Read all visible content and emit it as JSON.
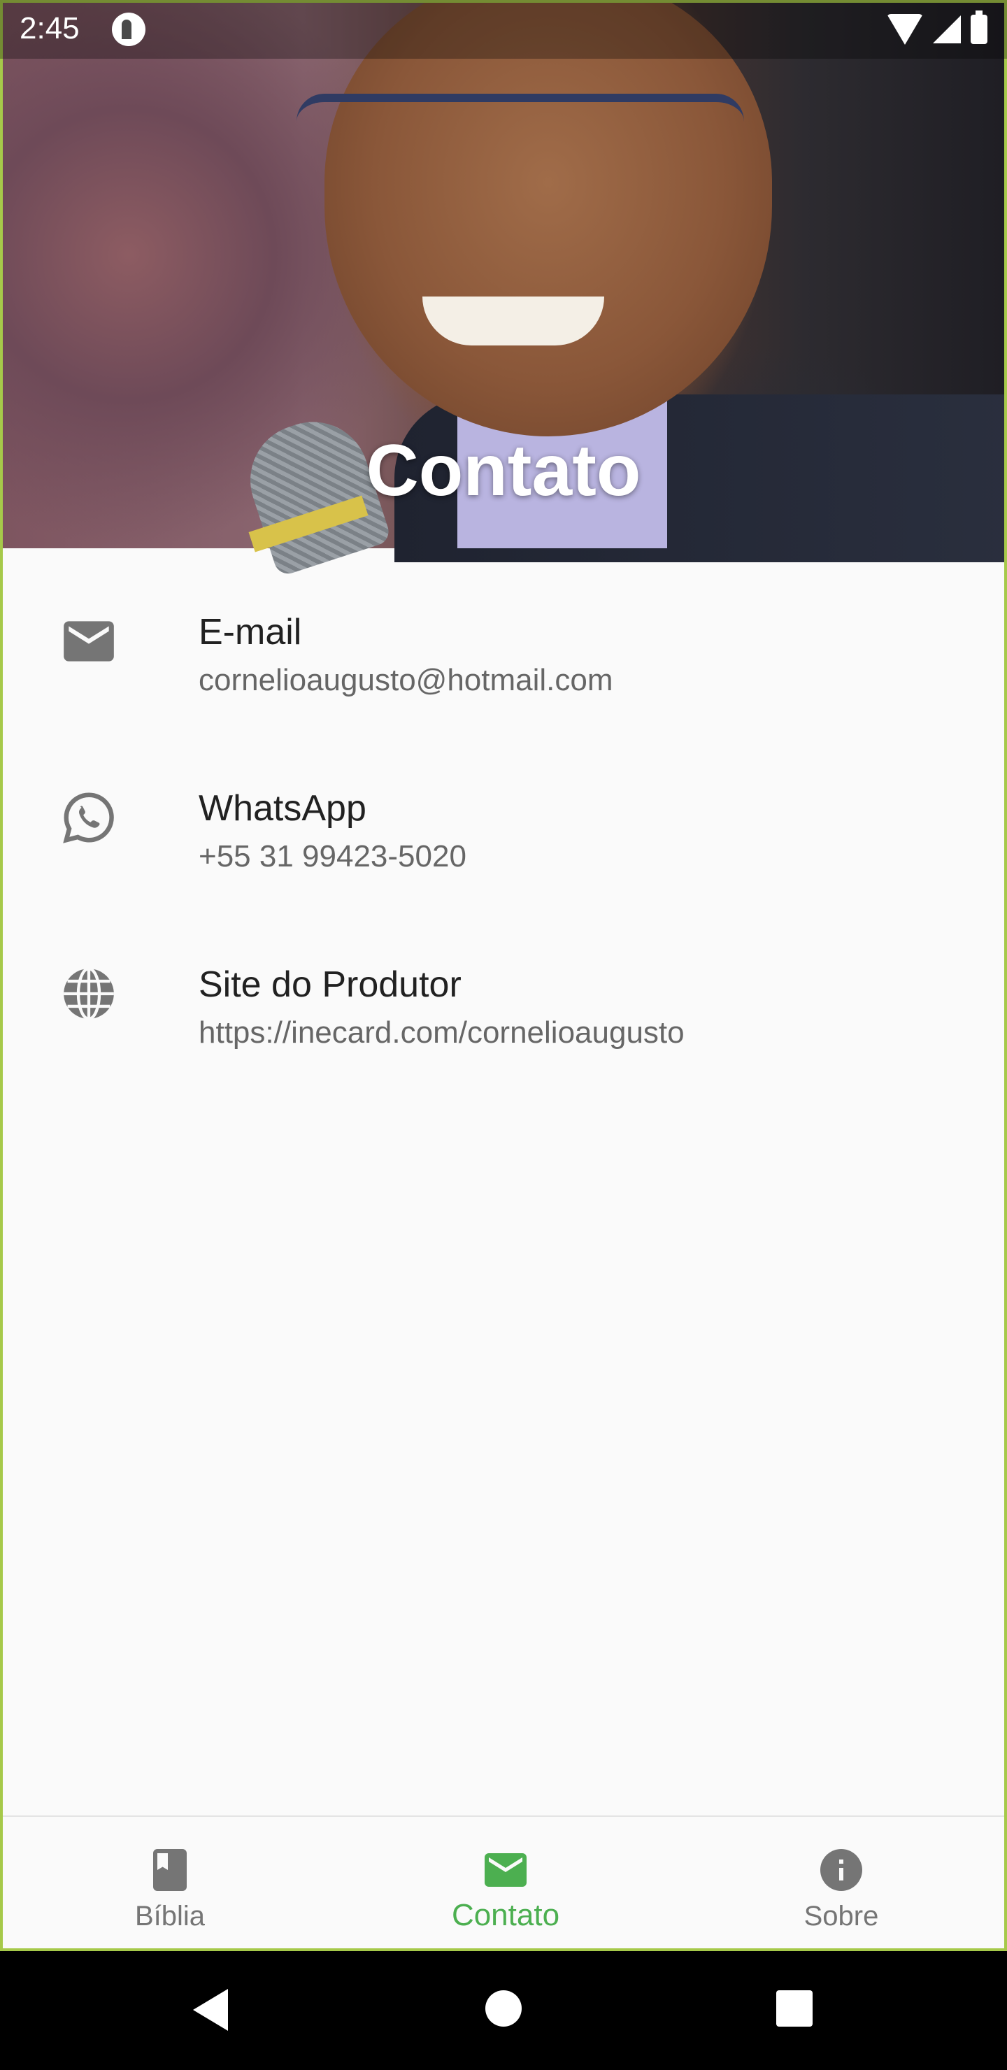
{
  "status_bar": {
    "time": "2:45"
  },
  "header": {
    "title": "Contato"
  },
  "contacts": [
    {
      "icon": "email-icon",
      "title": "E-mail",
      "value": "cornelioaugusto@hotmail.com"
    },
    {
      "icon": "whatsapp-icon",
      "title": "WhatsApp",
      "value": "+55 31 99423-5020"
    },
    {
      "icon": "globe-icon",
      "title": "Site do Produtor",
      "value": "https://inecard.com/cornelioaugusto"
    }
  ],
  "bottom_nav": {
    "items": [
      {
        "label": "Bíblia",
        "icon": "book-icon",
        "selected": false
      },
      {
        "label": "Contato",
        "icon": "email-icon",
        "selected": true
      },
      {
        "label": "Sobre",
        "icon": "info-icon",
        "selected": false
      }
    ]
  },
  "colors": {
    "accent": "#4caf50",
    "icon_grey": "#757575",
    "frame_border": "#a6c94a"
  }
}
